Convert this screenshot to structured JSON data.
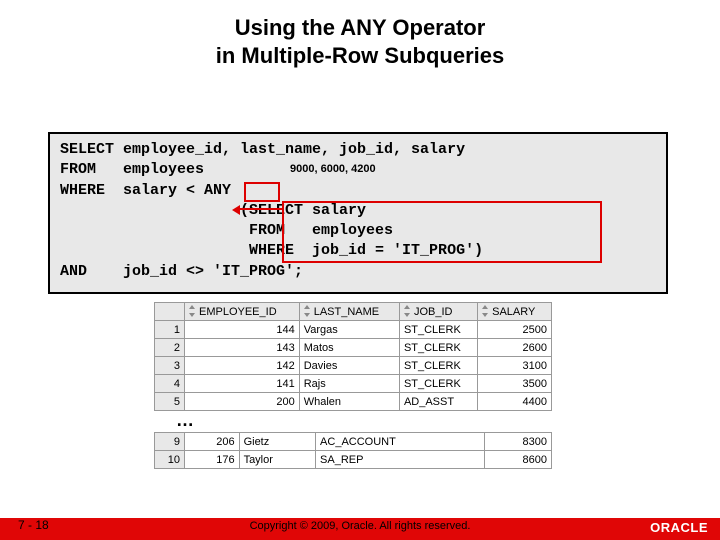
{
  "title_line1": "Using the ANY Operator",
  "title_line2": "in Multiple-Row Subqueries",
  "code": {
    "l1": "SELECT employee_id, last_name, job_id, salary",
    "l2": "FROM   employees",
    "l3": "WHERE  salary < ANY",
    "l4": "                    (SELECT salary",
    "l5": "                     FROM   employees",
    "l6": "                     WHERE  job_id = 'IT_PROG')",
    "l7": "AND    job_id <> 'IT_PROG';"
  },
  "annotation": "9000, 6000, 4200",
  "table": {
    "headers": {
      "c1": "EMPLOYEE_ID",
      "c2": "LAST_NAME",
      "c3": "JOB_ID",
      "c4": "SALARY"
    },
    "rows": [
      {
        "n": "1",
        "emp": "144",
        "ln": "Vargas",
        "job": "ST_CLERK",
        "sal": "2500"
      },
      {
        "n": "2",
        "emp": "143",
        "ln": "Matos",
        "job": "ST_CLERK",
        "sal": "2600"
      },
      {
        "n": "3",
        "emp": "142",
        "ln": "Davies",
        "job": "ST_CLERK",
        "sal": "3100"
      },
      {
        "n": "4",
        "emp": "141",
        "ln": "Rajs",
        "job": "ST_CLERK",
        "sal": "3500"
      },
      {
        "n": "5",
        "emp": "200",
        "ln": "Whalen",
        "job": "AD_ASST",
        "sal": "4400"
      }
    ],
    "rows2": [
      {
        "n": "9",
        "emp": "206",
        "ln": "Gietz",
        "job": "AC_ACCOUNT",
        "sal": "8300"
      },
      {
        "n": "10",
        "emp": "176",
        "ln": "Taylor",
        "job": "SA_REP",
        "sal": "8600"
      }
    ]
  },
  "ellipsis": "…",
  "page": "7 - 18",
  "copyright": "Copyright © 2009, Oracle. All rights reserved.",
  "brand": "ORACLE"
}
